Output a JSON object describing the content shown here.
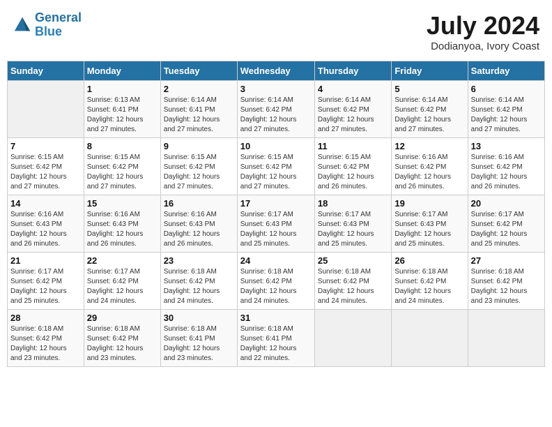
{
  "header": {
    "logo_line1": "General",
    "logo_line2": "Blue",
    "main_title": "July 2024",
    "subtitle": "Dodianyoa, Ivory Coast"
  },
  "calendar": {
    "days_of_week": [
      "Sunday",
      "Monday",
      "Tuesday",
      "Wednesday",
      "Thursday",
      "Friday",
      "Saturday"
    ],
    "weeks": [
      [
        {
          "day": "",
          "info": ""
        },
        {
          "day": "1",
          "info": "Sunrise: 6:13 AM\nSunset: 6:41 PM\nDaylight: 12 hours\nand 27 minutes."
        },
        {
          "day": "2",
          "info": "Sunrise: 6:14 AM\nSunset: 6:41 PM\nDaylight: 12 hours\nand 27 minutes."
        },
        {
          "day": "3",
          "info": "Sunrise: 6:14 AM\nSunset: 6:42 PM\nDaylight: 12 hours\nand 27 minutes."
        },
        {
          "day": "4",
          "info": "Sunrise: 6:14 AM\nSunset: 6:42 PM\nDaylight: 12 hours\nand 27 minutes."
        },
        {
          "day": "5",
          "info": "Sunrise: 6:14 AM\nSunset: 6:42 PM\nDaylight: 12 hours\nand 27 minutes."
        },
        {
          "day": "6",
          "info": "Sunrise: 6:14 AM\nSunset: 6:42 PM\nDaylight: 12 hours\nand 27 minutes."
        }
      ],
      [
        {
          "day": "7",
          "info": "Sunrise: 6:15 AM\nSunset: 6:42 PM\nDaylight: 12 hours\nand 27 minutes."
        },
        {
          "day": "8",
          "info": "Sunrise: 6:15 AM\nSunset: 6:42 PM\nDaylight: 12 hours\nand 27 minutes."
        },
        {
          "day": "9",
          "info": "Sunrise: 6:15 AM\nSunset: 6:42 PM\nDaylight: 12 hours\nand 27 minutes."
        },
        {
          "day": "10",
          "info": "Sunrise: 6:15 AM\nSunset: 6:42 PM\nDaylight: 12 hours\nand 27 minutes."
        },
        {
          "day": "11",
          "info": "Sunrise: 6:15 AM\nSunset: 6:42 PM\nDaylight: 12 hours\nand 26 minutes."
        },
        {
          "day": "12",
          "info": "Sunrise: 6:16 AM\nSunset: 6:42 PM\nDaylight: 12 hours\nand 26 minutes."
        },
        {
          "day": "13",
          "info": "Sunrise: 6:16 AM\nSunset: 6:42 PM\nDaylight: 12 hours\nand 26 minutes."
        }
      ],
      [
        {
          "day": "14",
          "info": "Sunrise: 6:16 AM\nSunset: 6:43 PM\nDaylight: 12 hours\nand 26 minutes."
        },
        {
          "day": "15",
          "info": "Sunrise: 6:16 AM\nSunset: 6:43 PM\nDaylight: 12 hours\nand 26 minutes."
        },
        {
          "day": "16",
          "info": "Sunrise: 6:16 AM\nSunset: 6:43 PM\nDaylight: 12 hours\nand 26 minutes."
        },
        {
          "day": "17",
          "info": "Sunrise: 6:17 AM\nSunset: 6:43 PM\nDaylight: 12 hours\nand 25 minutes."
        },
        {
          "day": "18",
          "info": "Sunrise: 6:17 AM\nSunset: 6:43 PM\nDaylight: 12 hours\nand 25 minutes."
        },
        {
          "day": "19",
          "info": "Sunrise: 6:17 AM\nSunset: 6:43 PM\nDaylight: 12 hours\nand 25 minutes."
        },
        {
          "day": "20",
          "info": "Sunrise: 6:17 AM\nSunset: 6:42 PM\nDaylight: 12 hours\nand 25 minutes."
        }
      ],
      [
        {
          "day": "21",
          "info": "Sunrise: 6:17 AM\nSunset: 6:42 PM\nDaylight: 12 hours\nand 25 minutes."
        },
        {
          "day": "22",
          "info": "Sunrise: 6:17 AM\nSunset: 6:42 PM\nDaylight: 12 hours\nand 24 minutes."
        },
        {
          "day": "23",
          "info": "Sunrise: 6:18 AM\nSunset: 6:42 PM\nDaylight: 12 hours\nand 24 minutes."
        },
        {
          "day": "24",
          "info": "Sunrise: 6:18 AM\nSunset: 6:42 PM\nDaylight: 12 hours\nand 24 minutes."
        },
        {
          "day": "25",
          "info": "Sunrise: 6:18 AM\nSunset: 6:42 PM\nDaylight: 12 hours\nand 24 minutes."
        },
        {
          "day": "26",
          "info": "Sunrise: 6:18 AM\nSunset: 6:42 PM\nDaylight: 12 hours\nand 24 minutes."
        },
        {
          "day": "27",
          "info": "Sunrise: 6:18 AM\nSunset: 6:42 PM\nDaylight: 12 hours\nand 23 minutes."
        }
      ],
      [
        {
          "day": "28",
          "info": "Sunrise: 6:18 AM\nSunset: 6:42 PM\nDaylight: 12 hours\nand 23 minutes."
        },
        {
          "day": "29",
          "info": "Sunrise: 6:18 AM\nSunset: 6:42 PM\nDaylight: 12 hours\nand 23 minutes."
        },
        {
          "day": "30",
          "info": "Sunrise: 6:18 AM\nSunset: 6:41 PM\nDaylight: 12 hours\nand 23 minutes."
        },
        {
          "day": "31",
          "info": "Sunrise: 6:18 AM\nSunset: 6:41 PM\nDaylight: 12 hours\nand 22 minutes."
        },
        {
          "day": "",
          "info": ""
        },
        {
          "day": "",
          "info": ""
        },
        {
          "day": "",
          "info": ""
        }
      ]
    ]
  }
}
